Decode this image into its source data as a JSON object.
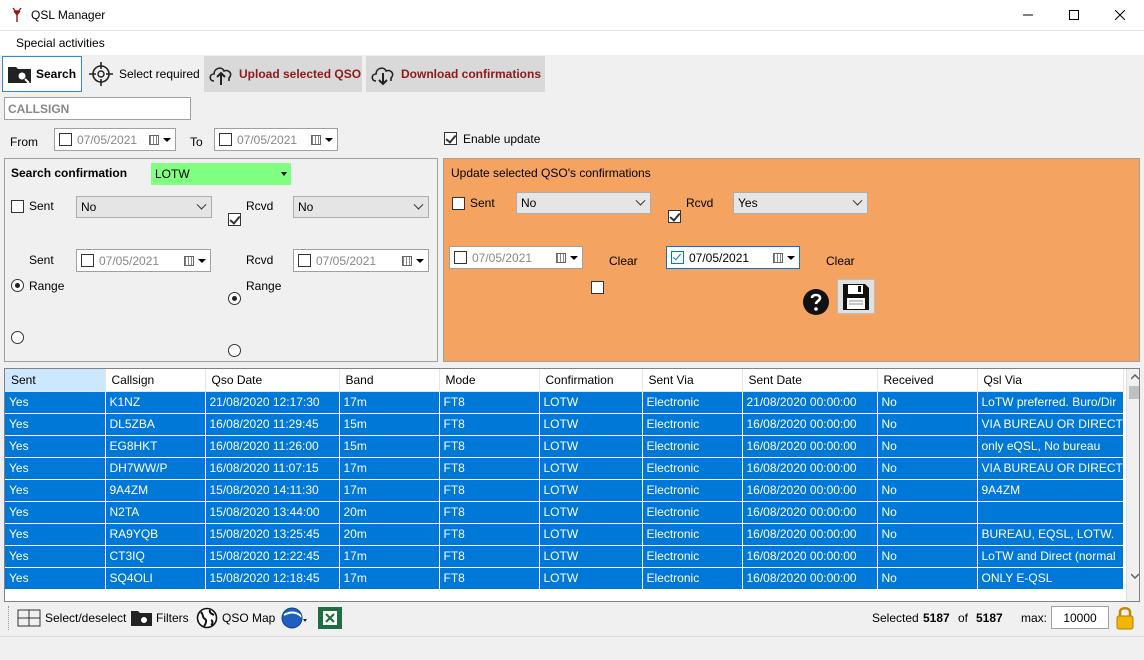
{
  "window": {
    "title": "QSL Manager"
  },
  "menu": {
    "items": [
      "Special activities"
    ]
  },
  "toolbar": {
    "search": "Search",
    "select_required": "Select required",
    "upload": "Upload selected QSO",
    "download": "Download confirmations"
  },
  "filters": {
    "callsign_placeholder": "CALLSIGN",
    "from_label": "From",
    "from_date": "07/05/2021",
    "to_label": "To",
    "to_date": "07/05/2021",
    "enable_update_label": "Enable update"
  },
  "search_panel": {
    "title": "Search confirmation",
    "service": "LOTW",
    "service_color": "#80ff80",
    "sent_label": "Sent",
    "sent_value": "No",
    "rcvd_label": "Rcvd",
    "rcvd_value": "No",
    "sent_radio_label": "Sent",
    "sent_date": "07/05/2021",
    "rcvd_radio_label": "Rcvd",
    "rcvd_date": "07/05/2021",
    "range_label_1": "Range",
    "range_label_2": "Range"
  },
  "update_panel": {
    "title": "Update selected QSO's confirmations",
    "bg_color": "#f4a460",
    "sent_label": "Sent",
    "sent_value": "No",
    "rcvd_label": "Rcvd",
    "rcvd_value": "Yes",
    "sent_date": "07/05/2021",
    "rcvd_date": "07/05/2021",
    "clear_label_1": "Clear",
    "clear_label_2": "Clear"
  },
  "table": {
    "columns": [
      "Sent",
      "Callsign",
      "Qso Date",
      "Band",
      "Mode",
      "Confirmation",
      "Sent Via",
      "Sent Date",
      "Received",
      "Qsl Via"
    ],
    "rows": [
      [
        "Yes",
        "K1NZ",
        "21/08/2020 12:17:30",
        "17m",
        "FT8",
        "LOTW",
        "Electronic",
        "21/08/2020 00:00:00",
        "No",
        "LoTW preferred. Buro/Dir"
      ],
      [
        "Yes",
        "DL5ZBA",
        "16/08/2020 11:29:45",
        "15m",
        "FT8",
        "LOTW",
        "Electronic",
        "16/08/2020 00:00:00",
        "No",
        "VIA BUREAU OR DIRECT"
      ],
      [
        "Yes",
        "EG8HKT",
        "16/08/2020 11:26:00",
        "15m",
        "FT8",
        "LOTW",
        "Electronic",
        "16/08/2020 00:00:00",
        "No",
        "only eQSL, No bureau"
      ],
      [
        "Yes",
        "DH7WW/P",
        "16/08/2020 11:07:15",
        "17m",
        "FT8",
        "LOTW",
        "Electronic",
        "16/08/2020 00:00:00",
        "No",
        "VIA BUREAU OR DIRECT -"
      ],
      [
        "Yes",
        "9A4ZM",
        "15/08/2020 14:11:30",
        "17m",
        "FT8",
        "LOTW",
        "Electronic",
        "16/08/2020 00:00:00",
        "No",
        "9A4ZM"
      ],
      [
        "Yes",
        "N2TA",
        "15/08/2020 13:44:00",
        "20m",
        "FT8",
        "LOTW",
        "Electronic",
        "16/08/2020 00:00:00",
        "No",
        ""
      ],
      [
        "Yes",
        "RA9YQB",
        "15/08/2020 13:25:45",
        "20m",
        "FT8",
        "LOTW",
        "Electronic",
        "16/08/2020 00:00:00",
        "No",
        "BUREAU, EQSL, LOTW."
      ],
      [
        "Yes",
        "CT3IQ",
        "15/08/2020 12:22:45",
        "17m",
        "FT8",
        "LOTW",
        "Electronic",
        "16/08/2020 00:00:00",
        "No",
        "LoTW and Direct (normal"
      ],
      [
        "Yes",
        "SQ4OLI",
        "15/08/2020 12:18:45",
        "17m",
        "FT8",
        "LOTW",
        "Electronic",
        "16/08/2020 00:00:00",
        "No",
        "ONLY E-QSL"
      ]
    ]
  },
  "bottom": {
    "select_deselect": "Select/deselect",
    "filters": "Filters",
    "qso_map": "QSO Map",
    "selected_label": "Selected",
    "selected_count": "5187",
    "of_label": "of",
    "total_count": "5187",
    "max_label": "max:",
    "max_value": "10000"
  }
}
